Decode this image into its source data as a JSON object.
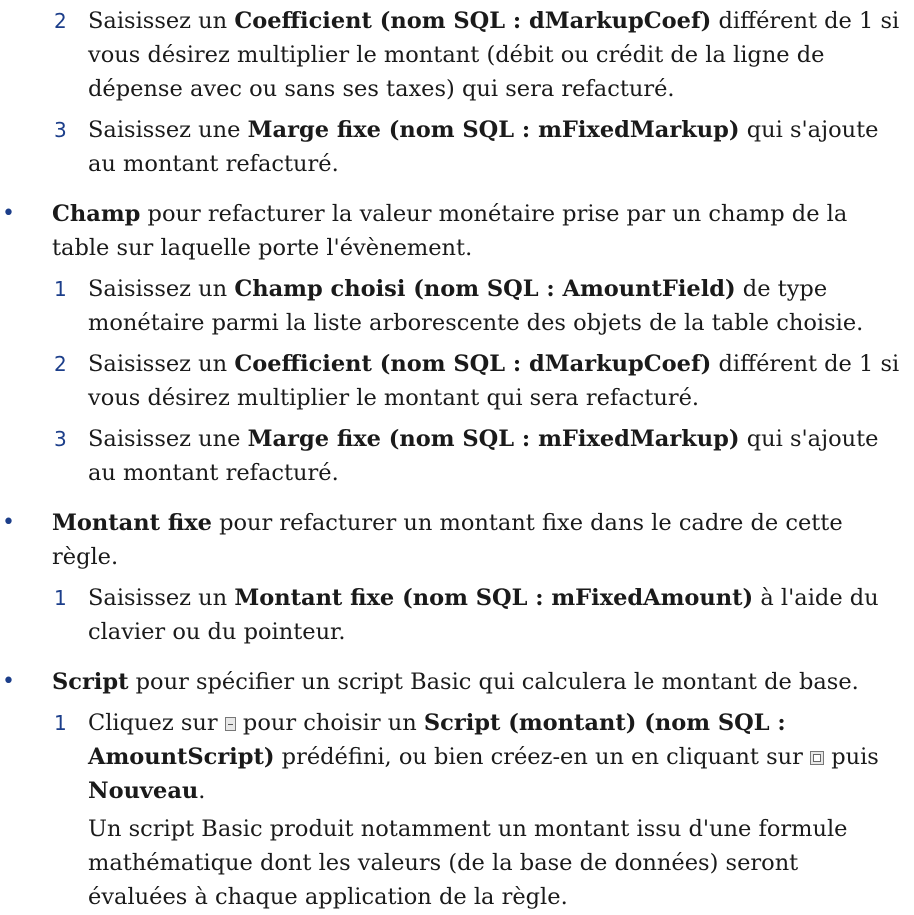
{
  "list_top": [
    {
      "num": "2",
      "t1": "Saisissez un ",
      "b1": "Coefficient (nom SQL : dMarkupCoef)",
      "t2": " différent de 1 si vous désirez multiplier le montant (débit ou crédit de la ligne de dépense avec ou sans ses taxes) qui sera refacturé."
    },
    {
      "num": "3",
      "t1": "Saisissez une ",
      "b1": "Marge fixe (nom SQL : mFixedMarkup)",
      "t2": " qui s'ajoute au montant refacturé."
    }
  ],
  "champ": {
    "bullet": "•",
    "b1": "Champ",
    "t1": " pour refacturer la valeur monétaire prise par un champ de la table sur laquelle porte l'évènement.",
    "steps": [
      {
        "num": "1",
        "t1": "Saisissez un ",
        "b1": "Champ choisi (nom SQL : AmountField)",
        "t2": " de type monétaire parmi la liste arborescente des objets de la table choisie."
      },
      {
        "num": "2",
        "t1": "Saisissez un ",
        "b1": "Coefficient (nom SQL : dMarkupCoef)",
        "t2": " différent de 1 si vous désirez multiplier le montant qui sera refacturé."
      },
      {
        "num": "3",
        "t1": "Saisissez une ",
        "b1": "Marge fixe (nom SQL : mFixedMarkup)",
        "t2": " qui s'ajoute au montant refacturé."
      }
    ]
  },
  "montant": {
    "bullet": "•",
    "b1": "Montant fixe",
    "t1": " pour refacturer un montant fixe dans le cadre de cette règle.",
    "steps": [
      {
        "num": "1",
        "t1": "Saisissez un ",
        "b1": "Montant fixe (nom SQL : mFixedAmount)",
        "t2": " à l'aide du clavier ou du pointeur."
      }
    ]
  },
  "script": {
    "bullet": "•",
    "b1": "Script",
    "t1": " pour spécifier un script Basic qui calculera le montant de base.",
    "step": {
      "num": "1",
      "t1": "Cliquez sur ",
      "icon1": "dropdown-button-icon",
      "t2": " pour choisir un ",
      "b1": "Script (montant) (nom SQL : AmountScript)",
      "t3": " prédéfini, ou bien créez-en un en cliquant sur ",
      "icon2": "zoom-button-icon",
      "t4": " puis ",
      "b2": "Nouveau",
      "t5": "."
    },
    "note": "Un script Basic produit notamment un montant issu d'une formule mathématique dont les valeurs (de la base de données) seront évaluées à chaque application de la règle."
  },
  "colors": {
    "numbering": "#1c3e8a",
    "text": "#1a1a1a"
  }
}
